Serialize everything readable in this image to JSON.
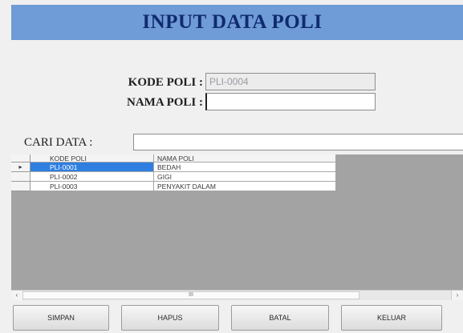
{
  "header": {
    "title": "INPUT DATA POLI"
  },
  "form": {
    "kode_label": "KODE POLI :",
    "kode_value": "PLI-0004",
    "nama_label": "NAMA POLI :",
    "nama_value": ""
  },
  "search": {
    "label": "CARI DATA :",
    "value": ""
  },
  "grid": {
    "columns": [
      "KODE POLI",
      "NAMA POLI"
    ],
    "current_row_marker": "▸",
    "rows": [
      {
        "kode": "PLI-0001",
        "nama": "BEDAH",
        "selected": true
      },
      {
        "kode": "PLI-0002",
        "nama": "GIGI",
        "selected": false
      },
      {
        "kode": "PLI-0003",
        "nama": "PENYAKIT DALAM",
        "selected": false
      }
    ],
    "selected_color": "#2f7fe0"
  },
  "scrollbar": {
    "left_glyph": "‹",
    "thumb_glyph": "III",
    "right_glyph": "›"
  },
  "buttons": {
    "simpan": "SIMPAN",
    "hapus": "HAPUS",
    "batal": "BATAL",
    "keluar": "KELUAR"
  },
  "colors": {
    "title_background": "#6f9bd6",
    "title_text": "#102a70",
    "grid_background": "#a3a3a3"
  }
}
